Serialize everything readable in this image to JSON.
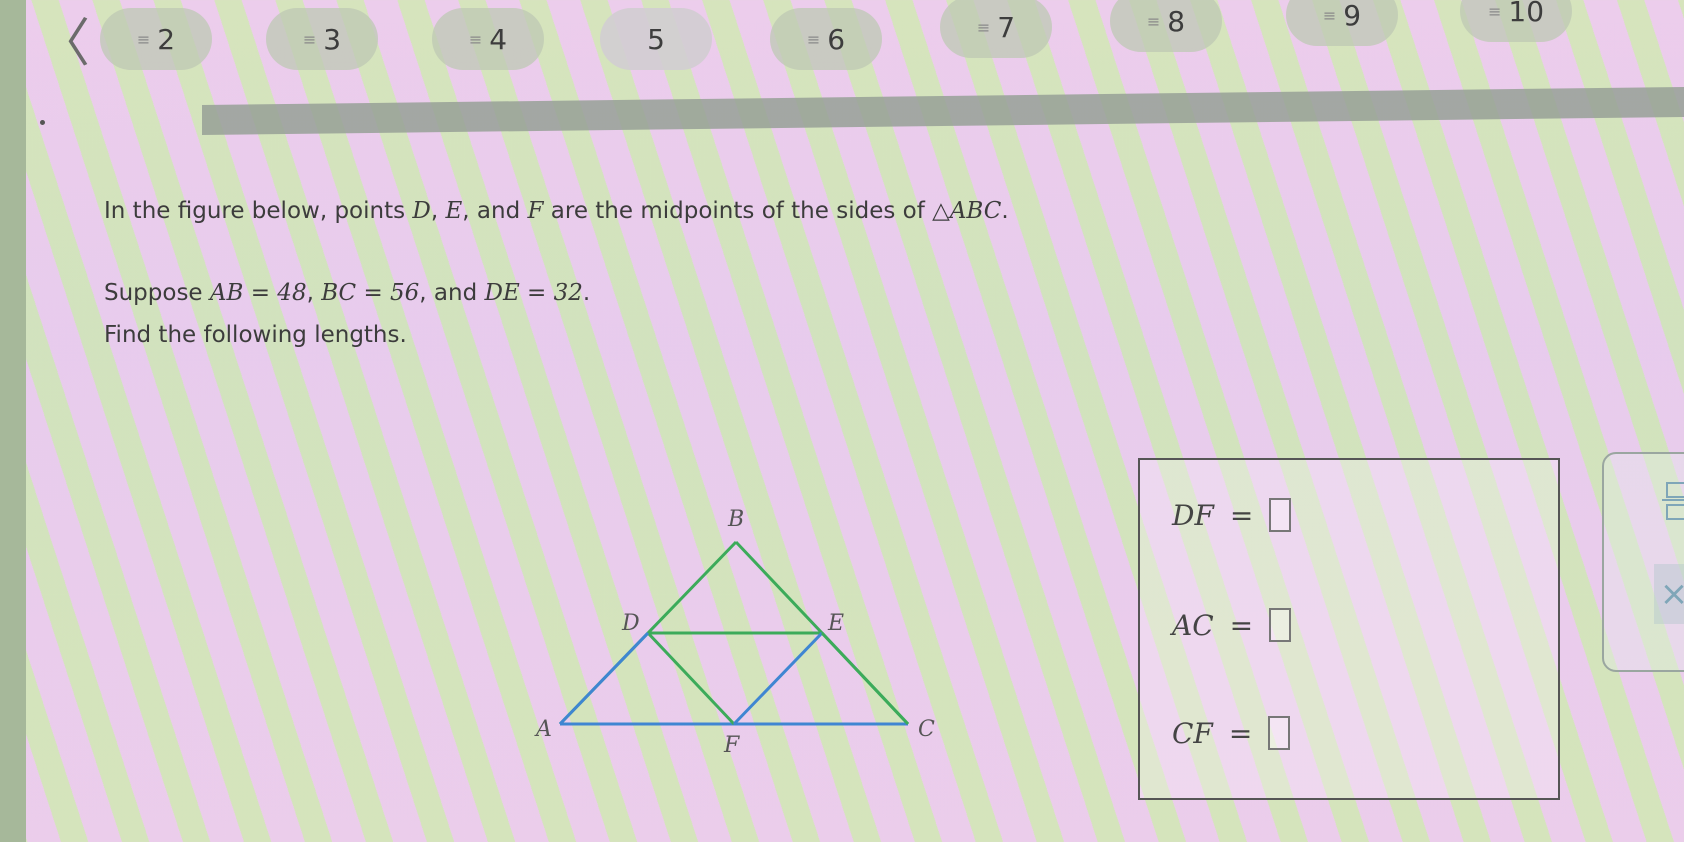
{
  "nav": {
    "back_symbol": "〈",
    "questions": [
      {
        "number": "2",
        "has_lines": true
      },
      {
        "number": "3",
        "has_lines": true
      },
      {
        "number": "4",
        "has_lines": true
      },
      {
        "number": "5",
        "has_lines": false
      },
      {
        "number": "6",
        "has_lines": true
      },
      {
        "number": "7",
        "has_lines": true
      },
      {
        "number": "8",
        "has_lines": true
      },
      {
        "number": "9",
        "has_lines": true
      },
      {
        "number": "10",
        "has_lines": true
      }
    ],
    "lines_icon": "≡"
  },
  "problem": {
    "line1_a": "In the figure below, points ",
    "D": "D",
    "sep1": ", ",
    "E": "E",
    "sep2": ", and ",
    "F": "F",
    "line1_b": " are the midpoints of the sides of ",
    "triangle": "△ABC",
    "period": ".",
    "line2_a": "Suppose ",
    "ab": "AB = 48",
    "comma": ", ",
    "bc": "BC = 56",
    "line2_b": ", and ",
    "de": "DE = 32",
    "period2": ".",
    "line3": "Find the following lengths."
  },
  "figure": {
    "labels": {
      "A": "A",
      "B": "B",
      "C": "C",
      "D": "D",
      "E": "E",
      "F": "F"
    },
    "colors": {
      "green": "#3cab5a",
      "blue": "#3f86d2"
    }
  },
  "answers": {
    "rows": [
      {
        "label": "DF",
        "eq": "=",
        "value": ""
      },
      {
        "label": "AC",
        "eq": "=",
        "value": ""
      },
      {
        "label": "CF",
        "eq": "=",
        "value": ""
      }
    ]
  },
  "tools": {
    "clear_symbol": "×"
  }
}
